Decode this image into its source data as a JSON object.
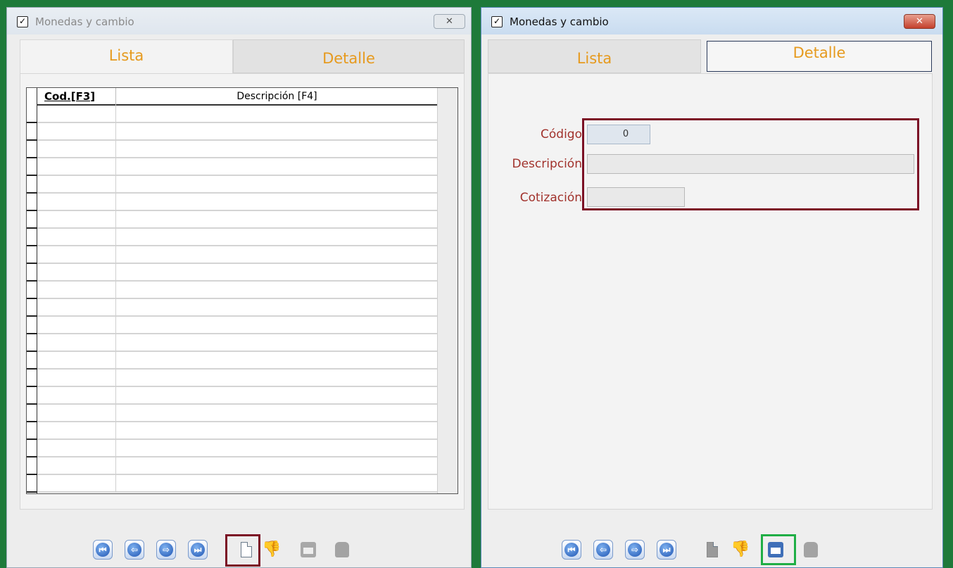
{
  "left_window": {
    "title": "Monedas y cambio",
    "close": "✕",
    "tabs": {
      "lista": "Lista",
      "detalle": "Detalle"
    },
    "grid": {
      "col_codigo": "Cod.[F3]",
      "col_descripcion": "Descripción [F4]"
    }
  },
  "right_window": {
    "title": "Monedas y cambio",
    "close": "✕",
    "tabs": {
      "lista": "Lista",
      "detalle": "Detalle"
    },
    "form": {
      "codigo_label": "Código",
      "codigo_value": "0",
      "descripcion_label": "Descripción",
      "descripcion_value": "",
      "cotizacion_label": "Cotización",
      "cotizacion_value": ""
    }
  },
  "toolbar": {
    "icons": [
      "first-record-icon",
      "previous-record-icon",
      "next-record-icon",
      "last-record-icon",
      "new-record-icon",
      "discard-icon",
      "save-icon",
      "delete-icon"
    ]
  },
  "colors": {
    "background": "#1e7a3a",
    "tab_text": "#e69a1e",
    "label_text": "#a1322c",
    "highlight_red": "#7b1025",
    "highlight_green": "#1fae45"
  }
}
